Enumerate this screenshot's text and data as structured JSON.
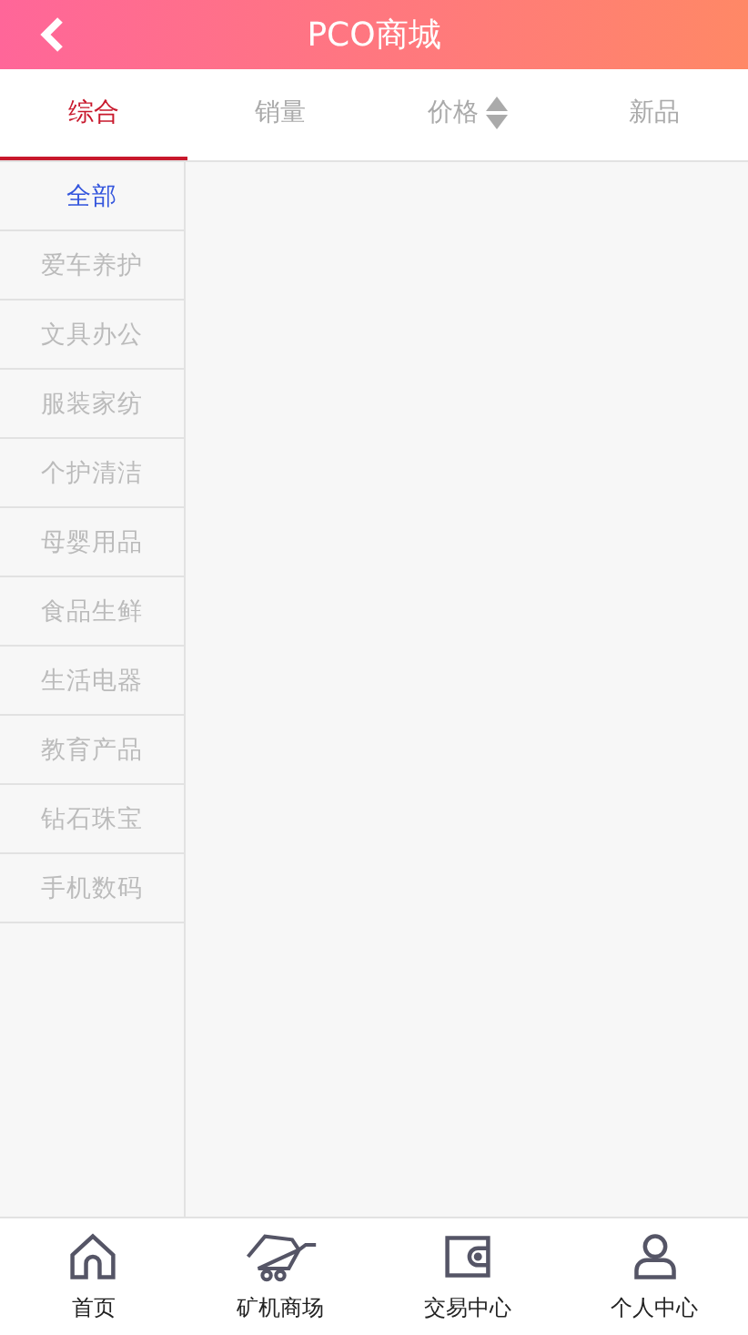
{
  "header": {
    "title": "PCO商城",
    "back_icon": true
  },
  "sort_tabs": [
    {
      "label": "综合",
      "selected": true,
      "kind": "plain"
    },
    {
      "label": "销量",
      "selected": false,
      "kind": "plain"
    },
    {
      "label": "价格",
      "selected": false,
      "kind": "sortable"
    },
    {
      "label": "新品",
      "selected": false,
      "kind": "plain"
    }
  ],
  "categories": [
    {
      "label": "全部",
      "selected": true
    },
    {
      "label": "爱车养护",
      "selected": false
    },
    {
      "label": "文具办公",
      "selected": false
    },
    {
      "label": "服装家纺",
      "selected": false
    },
    {
      "label": "个护清洁",
      "selected": false
    },
    {
      "label": "母婴用品",
      "selected": false
    },
    {
      "label": "食品生鲜",
      "selected": false
    },
    {
      "label": "生活电器",
      "selected": false
    },
    {
      "label": "教育产品",
      "selected": false
    },
    {
      "label": "钻石珠宝",
      "selected": false
    },
    {
      "label": "手机数码",
      "selected": false
    }
  ],
  "bottom_nav": [
    {
      "label": "首页",
      "kind": "home"
    },
    {
      "label": "矿机商场",
      "kind": "cart"
    },
    {
      "label": "交易中心",
      "kind": "wallet"
    },
    {
      "label": "个人中心",
      "kind": "user"
    }
  ]
}
